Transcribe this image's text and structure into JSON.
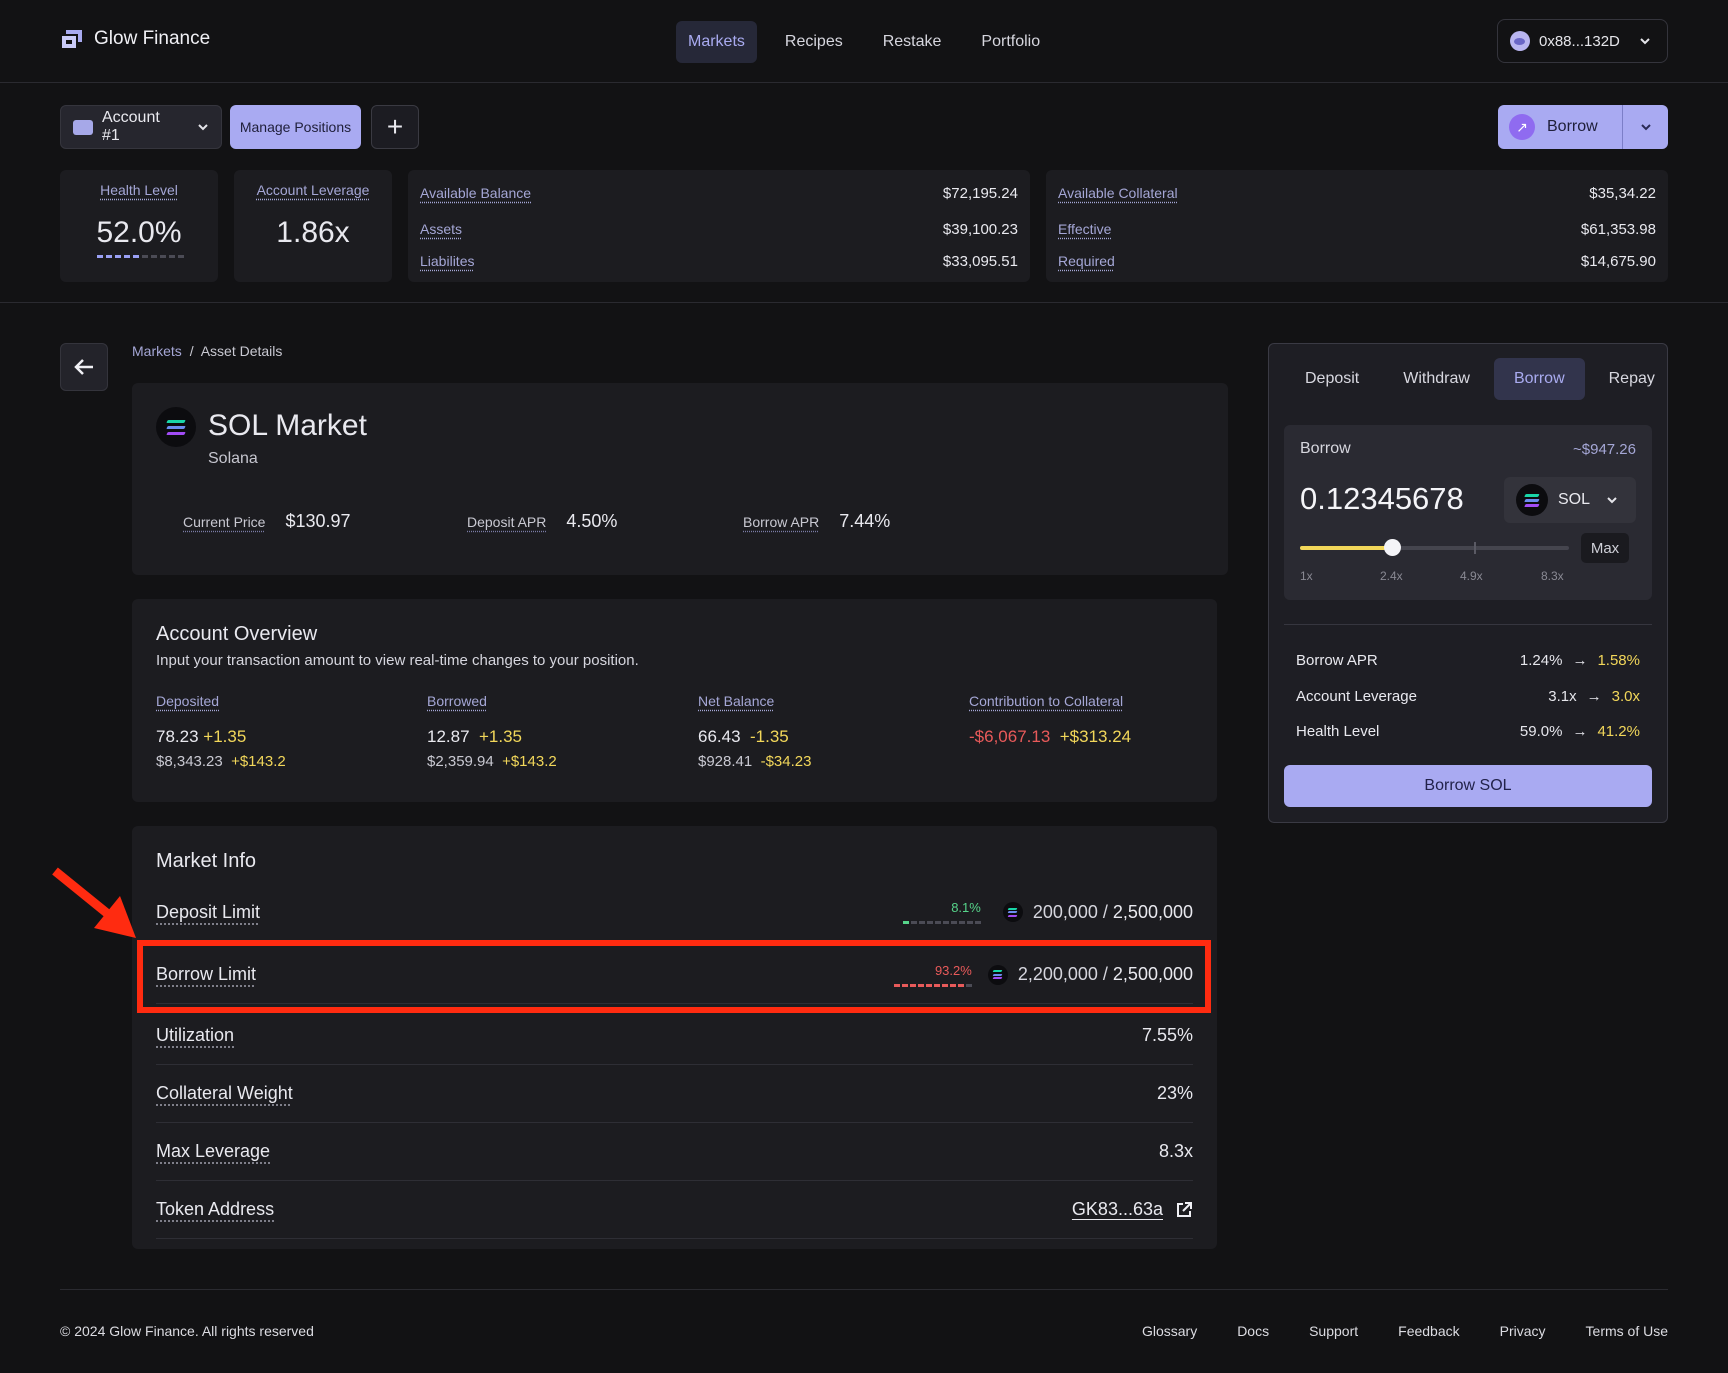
{
  "header": {
    "brand": "Glow Finance",
    "nav": [
      {
        "label": "Markets",
        "active": true
      },
      {
        "label": "Recipes",
        "active": false
      },
      {
        "label": "Restake",
        "active": false
      },
      {
        "label": "Portfolio",
        "active": false
      }
    ],
    "wallet": "0x88...132D"
  },
  "toolbar": {
    "account": "Account #1",
    "manage": "Manage Positions",
    "add": "+",
    "borrow": "Borrow"
  },
  "stats": {
    "health_label": "Health Level",
    "health_value": "52.0%",
    "health_level_fraction": 0.52,
    "leverage_label": "Account Leverage",
    "leverage_value": "1.86x",
    "balance": [
      {
        "label": "Available Balance",
        "value": "$72,195.24"
      },
      {
        "label": "Assets",
        "value": "$39,100.23"
      },
      {
        "label": "Liabilites",
        "value": "$33,095.51"
      }
    ],
    "collateral": [
      {
        "label": "Available Collateral",
        "value": "$35,34.22"
      },
      {
        "label": "Effective",
        "value": "$61,353.98"
      },
      {
        "label": "Required",
        "value": "$14,675.90"
      }
    ]
  },
  "breadcrumb": {
    "root": "Markets",
    "sep": "/",
    "current": "Asset Details"
  },
  "market": {
    "title": "SOL Market",
    "subtitle": "Solana",
    "metrics": [
      {
        "label": "Current Price",
        "value": "$130.97"
      },
      {
        "label": "Deposit APR",
        "value": "4.50%"
      },
      {
        "label": "Borrow APR",
        "value": "7.44%"
      }
    ]
  },
  "overview": {
    "title": "Account Overview",
    "desc": "Input your transaction amount to view real-time changes to your position.",
    "cols": [
      {
        "label": "Deposited",
        "v1": "78.23",
        "d1": "+1.35",
        "v2": "$8,343.23",
        "d2": "+$143.2"
      },
      {
        "label": "Borrowed",
        "v1": "12.87",
        "d1": "+1.35",
        "v2": "$2,359.94",
        "d2": "+$143.2"
      },
      {
        "label": "Net Balance",
        "v1": "66.43",
        "d1": "-1.35",
        "v2": "$928.41",
        "d2": "-$34.23"
      },
      {
        "label": "Contribution to Collateral",
        "v1": "-$6,067.13",
        "d1": "+$313.24"
      }
    ]
  },
  "market_info": {
    "title": "Market Info",
    "deposit_limit": {
      "label": "Deposit Limit",
      "pct": "8.1%",
      "fraction": 0.081,
      "used": "200,000",
      "sep": " / ",
      "total": "2,500,000"
    },
    "borrow_limit": {
      "label": "Borrow Limit",
      "pct": "93.2%",
      "fraction": 0.932,
      "used": "2,200,000",
      "sep": " / ",
      "total": "2,500,000"
    },
    "rows": [
      {
        "label": "Utilization",
        "value": "7.55%"
      },
      {
        "label": "Collateral Weight",
        "value": "23%"
      },
      {
        "label": "Max Leverage",
        "value": "8.3x"
      }
    ],
    "token_address_label": "Token Address",
    "token_address": "GK83...63a"
  },
  "panel": {
    "tabs": [
      {
        "label": "Deposit",
        "active": false
      },
      {
        "label": "Withdraw",
        "active": false
      },
      {
        "label": "Borrow",
        "active": true
      },
      {
        "label": "Repay",
        "active": false
      }
    ],
    "input_label": "Borrow",
    "usd": "~$947.26",
    "amount": "0.12345678",
    "token": "SOL",
    "max": "Max",
    "slider_marks": [
      "1x",
      "2.4x",
      "4.9x",
      "8.3x"
    ],
    "slider_value": "2.4x",
    "summary": [
      {
        "label": "Borrow APR",
        "from": "1.24%",
        "arrow": "→",
        "to": "1.58%"
      },
      {
        "label": "Account Leverage",
        "from": "3.1x",
        "arrow": "→",
        "to": "3.0x"
      },
      {
        "label": "Health Level",
        "from": "59.0%",
        "arrow": "→",
        "to": "41.2%"
      }
    ],
    "submit": "Borrow SOL"
  },
  "footer": {
    "copyright": "© 2024 Glow Finance. All rights reserved",
    "links": [
      "Glossary",
      "Docs",
      "Support",
      "Feedback",
      "Privacy",
      "Terms of Use"
    ]
  },
  "colors": {
    "accent": "#a9aaf2",
    "positive_delta": "#f2d75a",
    "negative": "#e85a5a",
    "deposit_bar": "#56d48a",
    "highlight_box": "#ff2b10",
    "sol_gradient": [
      "#14f195",
      "#9945ff"
    ]
  }
}
